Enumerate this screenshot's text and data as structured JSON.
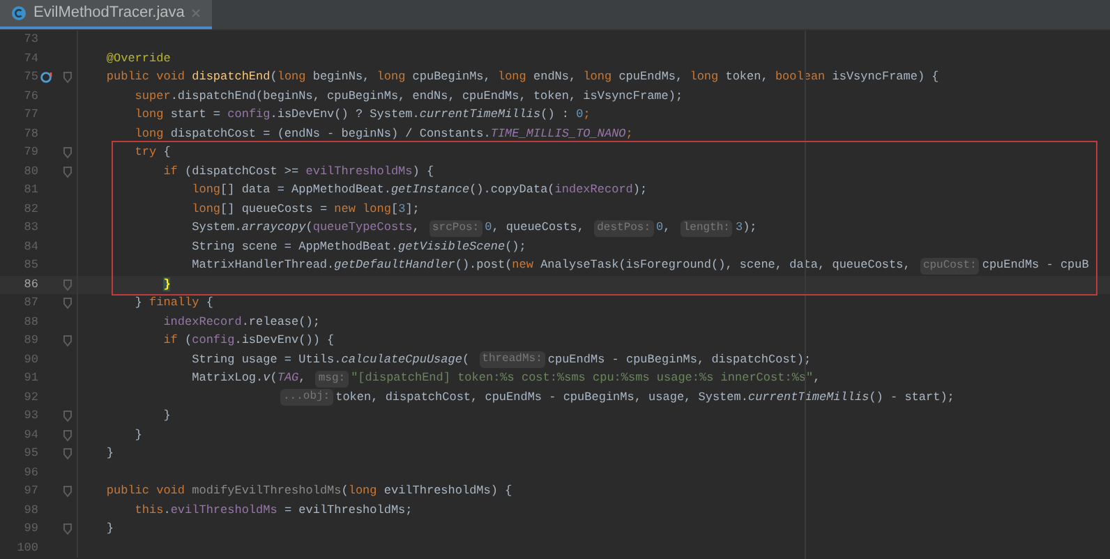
{
  "tabs": [
    {
      "title": "EvilMethodTracer.java",
      "selected": true
    }
  ],
  "lines": [
    {
      "number": "73",
      "current": false,
      "fold": false,
      "override": false
    },
    {
      "number": "74",
      "current": false,
      "fold": false,
      "override": false,
      "tokens": [
        {
          "kind": "annot",
          "text": "    @Override"
        }
      ]
    },
    {
      "number": "75",
      "current": false,
      "fold": true,
      "override": true,
      "tokens": [
        {
          "kind": "kw",
          "text": "    public void "
        },
        {
          "kind": "decl",
          "text": "dispatchEnd"
        },
        {
          "kind": "plain",
          "text": "("
        },
        {
          "kind": "kw",
          "text": "long"
        },
        {
          "kind": "plain",
          "text": " beginNs, "
        },
        {
          "kind": "kw",
          "text": "long"
        },
        {
          "kind": "plain",
          "text": " cpuBeginMs, "
        },
        {
          "kind": "kw",
          "text": "long"
        },
        {
          "kind": "plain",
          "text": " endNs, "
        },
        {
          "kind": "kw",
          "text": "long"
        },
        {
          "kind": "plain",
          "text": " cpuEndMs, "
        },
        {
          "kind": "kw",
          "text": "long"
        },
        {
          "kind": "plain",
          "text": " token, "
        },
        {
          "kind": "kw",
          "text": "boolean"
        },
        {
          "kind": "plain",
          "text": " isVsyncFrame) {"
        }
      ]
    },
    {
      "number": "76",
      "current": false,
      "fold": false,
      "override": false,
      "tokens": [
        {
          "kind": "kw",
          "text": "        super"
        },
        {
          "kind": "plain",
          "text": ".dispatchEnd(beginNs, cpuBeginMs, endNs, cpuEndMs, token, isVsyncFrame);"
        }
      ]
    },
    {
      "number": "77",
      "current": false,
      "fold": false,
      "override": false,
      "tokens": [
        {
          "kind": "kw",
          "text": "        long"
        },
        {
          "kind": "plain",
          "text": " start = "
        },
        {
          "kind": "field",
          "text": "config"
        },
        {
          "kind": "plain",
          "text": ".isDevEnv() ? System."
        },
        {
          "kind": "italic",
          "text": "currentTimeMillis"
        },
        {
          "kind": "plain",
          "text": "() : "
        },
        {
          "kind": "num",
          "text": "0"
        },
        {
          "kind": "kw",
          "text": ";"
        }
      ]
    },
    {
      "number": "78",
      "current": false,
      "fold": false,
      "override": false,
      "tokens": [
        {
          "kind": "kw",
          "text": "        long"
        },
        {
          "kind": "plain",
          "text": " dispatchCost = (endNs - beginNs) / Constants."
        },
        {
          "kind": "const",
          "text": "TIME_MILLIS_TO_NANO"
        },
        {
          "kind": "kw",
          "text": ";"
        }
      ]
    },
    {
      "number": "79",
      "current": false,
      "fold": true,
      "override": false,
      "tokens": [
        {
          "kind": "kw",
          "text": "        try"
        },
        {
          "kind": "plain",
          "text": " {"
        }
      ]
    },
    {
      "number": "80",
      "current": false,
      "fold": true,
      "override": false,
      "tokens": [
        {
          "kind": "kw",
          "text": "            if"
        },
        {
          "kind": "plain",
          "text": " (dispatchCost >= "
        },
        {
          "kind": "field",
          "text": "evilThresholdMs"
        },
        {
          "kind": "plain",
          "text": ") {"
        }
      ]
    },
    {
      "number": "81",
      "current": false,
      "fold": false,
      "override": false,
      "tokens": [
        {
          "kind": "kw",
          "text": "                long"
        },
        {
          "kind": "plain",
          "text": "[] data = AppMethodBeat."
        },
        {
          "kind": "italic",
          "text": "getInstance"
        },
        {
          "kind": "plain",
          "text": "().copyData("
        },
        {
          "kind": "field",
          "text": "indexRecord"
        },
        {
          "kind": "plain",
          "text": ");"
        }
      ]
    },
    {
      "number": "82",
      "current": false,
      "fold": false,
      "override": false,
      "tokens": [
        {
          "kind": "kw",
          "text": "                long"
        },
        {
          "kind": "plain",
          "text": "[] queueCosts = "
        },
        {
          "kind": "kw",
          "text": "new long"
        },
        {
          "kind": "plain",
          "text": "["
        },
        {
          "kind": "num",
          "text": "3"
        },
        {
          "kind": "plain",
          "text": "];"
        }
      ]
    },
    {
      "number": "83",
      "current": false,
      "fold": false,
      "override": false,
      "tokens": [
        {
          "kind": "plain",
          "text": "                System."
        },
        {
          "kind": "italic",
          "text": "arraycopy"
        },
        {
          "kind": "plain",
          "text": "("
        },
        {
          "kind": "field",
          "text": "queueTypeCosts"
        },
        {
          "kind": "plain",
          "text": ", "
        },
        {
          "kind": "hint",
          "text": "srcPos:"
        },
        {
          "kind": "num",
          "text": "0"
        },
        {
          "kind": "plain",
          "text": ", queueCosts, "
        },
        {
          "kind": "hint",
          "text": "destPos:"
        },
        {
          "kind": "num",
          "text": "0"
        },
        {
          "kind": "plain",
          "text": ", "
        },
        {
          "kind": "hint",
          "text": "length:"
        },
        {
          "kind": "num",
          "text": "3"
        },
        {
          "kind": "plain",
          "text": ");"
        }
      ]
    },
    {
      "number": "84",
      "current": false,
      "fold": false,
      "override": false,
      "tokens": [
        {
          "kind": "plain",
          "text": "                String scene = AppMethodBeat."
        },
        {
          "kind": "italic",
          "text": "getVisibleScene"
        },
        {
          "kind": "plain",
          "text": "();"
        }
      ]
    },
    {
      "number": "85",
      "current": false,
      "fold": false,
      "override": false,
      "tokens": [
        {
          "kind": "plain",
          "text": "                MatrixHandlerThread."
        },
        {
          "kind": "italic",
          "text": "getDefaultHandler"
        },
        {
          "kind": "plain",
          "text": "().post("
        },
        {
          "kind": "kw",
          "text": "new"
        },
        {
          "kind": "plain",
          "text": " AnalyseTask(isForeground(), scene, data, queueCosts, "
        },
        {
          "kind": "hint",
          "text": "cpuCost:"
        },
        {
          "kind": "plain",
          "text": "cpuEndMs - cpuB"
        }
      ]
    },
    {
      "number": "86",
      "current": true,
      "fold": true,
      "override": false,
      "tokens": [
        {
          "kind": "match",
          "text": "            }"
        }
      ]
    },
    {
      "number": "87",
      "current": false,
      "fold": true,
      "override": false,
      "tokens": [
        {
          "kind": "plain",
          "text": "        } "
        },
        {
          "kind": "kw",
          "text": "finally"
        },
        {
          "kind": "plain",
          "text": " {"
        }
      ]
    },
    {
      "number": "88",
      "current": false,
      "fold": false,
      "override": false,
      "tokens": [
        {
          "kind": "field",
          "text": "            indexRecord"
        },
        {
          "kind": "plain",
          "text": ".release();"
        }
      ]
    },
    {
      "number": "89",
      "current": false,
      "fold": true,
      "override": false,
      "tokens": [
        {
          "kind": "kw",
          "text": "            if"
        },
        {
          "kind": "plain",
          "text": " ("
        },
        {
          "kind": "field",
          "text": "config"
        },
        {
          "kind": "plain",
          "text": ".isDevEnv()) {"
        }
      ]
    },
    {
      "number": "90",
      "current": false,
      "fold": false,
      "override": false,
      "tokens": [
        {
          "kind": "plain",
          "text": "                String usage = Utils."
        },
        {
          "kind": "italic",
          "text": "calculateCpuUsage"
        },
        {
          "kind": "plain",
          "text": "( "
        },
        {
          "kind": "hint",
          "text": "threadMs:"
        },
        {
          "kind": "plain",
          "text": "cpuEndMs - cpuBeginMs, dispatchCost);"
        }
      ]
    },
    {
      "number": "91",
      "current": false,
      "fold": false,
      "override": false,
      "tokens": [
        {
          "kind": "plain",
          "text": "                MatrixLog."
        },
        {
          "kind": "italic",
          "text": "v"
        },
        {
          "kind": "plain",
          "text": "("
        },
        {
          "kind": "const",
          "text": "TAG"
        },
        {
          "kind": "plain",
          "text": ", "
        },
        {
          "kind": "hint",
          "text": "msg:"
        },
        {
          "kind": "str",
          "text": "\"[dispatchEnd] token:%s cost:%sms cpu:%sms usage:%s innerCost:%s\""
        },
        {
          "kind": "plain",
          "text": ","
        }
      ]
    },
    {
      "number": "92",
      "current": false,
      "fold": false,
      "override": false,
      "tokens": [
        {
          "kind": "hint",
          "text": "...obj:"
        },
        {
          "kind": "plain",
          "text": "token, dispatchCost, cpuEndMs - cpuBeginMs, usage, System."
        },
        {
          "kind": "italic",
          "text": "currentTimeMillis"
        },
        {
          "kind": "plain",
          "text": "() - start);"
        }
      ]
    },
    {
      "number": "93",
      "current": false,
      "fold": true,
      "override": false,
      "tokens": [
        {
          "kind": "plain",
          "text": "            }"
        }
      ]
    },
    {
      "number": "94",
      "current": false,
      "fold": true,
      "override": false,
      "tokens": [
        {
          "kind": "plain",
          "text": "        }"
        }
      ]
    },
    {
      "number": "95",
      "current": false,
      "fold": true,
      "override": false,
      "tokens": [
        {
          "kind": "plain",
          "text": "    }"
        }
      ]
    },
    {
      "number": "96",
      "current": false,
      "fold": false,
      "override": false
    },
    {
      "number": "97",
      "current": false,
      "fold": true,
      "override": false,
      "tokens": [
        {
          "kind": "kw",
          "text": "    public void "
        },
        {
          "kind": "unused",
          "text": "modifyEvilThresholdMs"
        },
        {
          "kind": "plain",
          "text": "("
        },
        {
          "kind": "kw",
          "text": "long"
        },
        {
          "kind": "plain",
          "text": " evilThresholdMs) {"
        }
      ]
    },
    {
      "number": "98",
      "current": false,
      "fold": false,
      "override": false,
      "tokens": [
        {
          "kind": "kw",
          "text": "        this"
        },
        {
          "kind": "plain",
          "text": "."
        },
        {
          "kind": "field",
          "text": "evilThresholdMs"
        },
        {
          "kind": "plain",
          "text": " = evilThresholdMs;"
        }
      ]
    },
    {
      "number": "99",
      "current": false,
      "fold": true,
      "override": false,
      "tokens": [
        {
          "kind": "plain",
          "text": "    }"
        }
      ]
    },
    {
      "number": "100",
      "current": false,
      "fold": false,
      "override": false
    }
  ]
}
